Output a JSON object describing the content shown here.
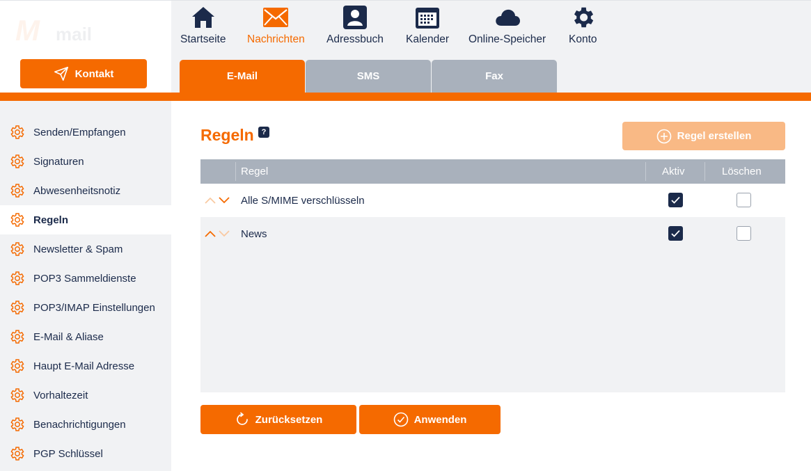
{
  "brand": {
    "logo_text": "mail",
    "logo_mark": "M"
  },
  "contact_button": {
    "label": "Kontakt",
    "icon": "paper-plane-icon"
  },
  "top_nav": [
    {
      "label": "Startseite",
      "icon": "home-icon",
      "active": false
    },
    {
      "label": "Nachrichten",
      "icon": "envelope-icon",
      "active": true
    },
    {
      "label": "Adressbuch",
      "icon": "contact-book-icon",
      "active": false
    },
    {
      "label": "Kalender",
      "icon": "calendar-icon",
      "active": false
    },
    {
      "label": "Online-Speicher",
      "icon": "cloud-icon",
      "active": false
    },
    {
      "label": "Konto",
      "icon": "gear-icon",
      "active": false
    }
  ],
  "tabs": [
    {
      "label": "E-Mail",
      "active": true
    },
    {
      "label": "SMS",
      "active": false
    },
    {
      "label": "Fax",
      "active": false
    }
  ],
  "sidebar": {
    "items": [
      {
        "label": "Senden/Empfangen",
        "active": false
      },
      {
        "label": "Signaturen",
        "active": false
      },
      {
        "label": "Abwesenheitsnotiz",
        "active": false
      },
      {
        "label": "Regeln",
        "active": true
      },
      {
        "label": "Newsletter & Spam",
        "active": false
      },
      {
        "label": "POP3 Sammeldienste",
        "active": false
      },
      {
        "label": "POP3/IMAP Einstellungen",
        "active": false
      },
      {
        "label": "E-Mail & Aliase",
        "active": false
      },
      {
        "label": "Haupt E-Mail Adresse",
        "active": false
      },
      {
        "label": "Vorhaltezeit",
        "active": false
      },
      {
        "label": "Benachrichtigungen",
        "active": false
      },
      {
        "label": "PGP Schlüssel",
        "active": false
      }
    ]
  },
  "main": {
    "title": "Regeln",
    "help_label": "?",
    "create_button": "Regel erstellen",
    "table": {
      "columns": {
        "rule": "Regel",
        "active": "Aktiv",
        "delete": "Löschen"
      },
      "rows": [
        {
          "name": "Alle S/MIME verschlüsseln",
          "active": true,
          "delete": false,
          "can_move_up": false,
          "can_move_down": true
        },
        {
          "name": "News",
          "active": true,
          "delete": false,
          "can_move_up": true,
          "can_move_down": false
        }
      ]
    },
    "reset_button": "Zurücksetzen",
    "apply_button": "Anwenden"
  },
  "colors": {
    "accent": "#f56a00",
    "accent_light": "#f9b985",
    "navy": "#1b2a4a",
    "gray_tab": "#a9b1bc",
    "panel_bg": "#f1f2f4"
  }
}
